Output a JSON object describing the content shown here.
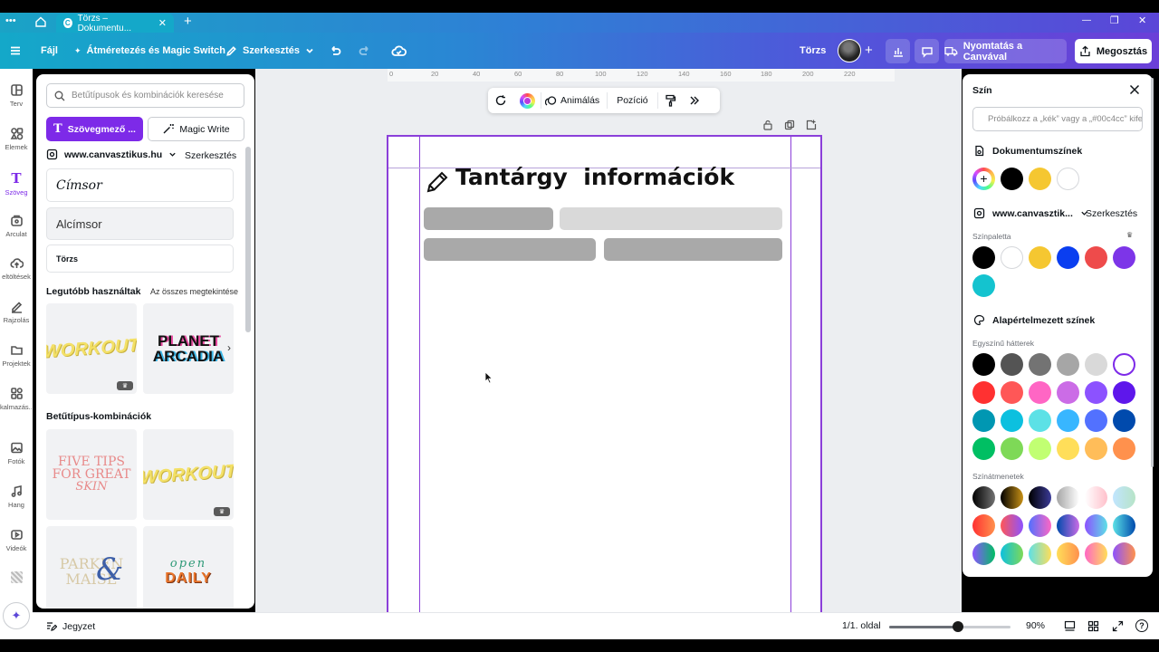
{
  "browser": {
    "tab_title": "Törzs – Dokumentu...",
    "tab_close": "✕",
    "new_tab": "+",
    "win_min": "—",
    "win_max": "❐",
    "win_close": "✕"
  },
  "toolbar": {
    "file": "Fájl",
    "resize": "Átméretezés és Magic Switch",
    "edit": "Szerkesztés",
    "doc_title": "Törzs",
    "print": "Nyomtatás a Canvával",
    "share": "Megosztás"
  },
  "rail": [
    {
      "label": "Terv",
      "icon": "layout-icon"
    },
    {
      "label": "Elemek",
      "icon": "shapes-icon"
    },
    {
      "label": "Szöveg",
      "icon": "text-icon"
    },
    {
      "label": "Arculat",
      "icon": "brand-icon"
    },
    {
      "label": "eltöltések",
      "icon": "upload-icon"
    },
    {
      "label": "Rajzolás",
      "icon": "draw-icon"
    },
    {
      "label": "Projektek",
      "icon": "folder-icon"
    },
    {
      "label": "kalmazás...",
      "icon": "apps-icon"
    },
    {
      "label": "Fotók",
      "icon": "photo-icon"
    },
    {
      "label": "Hang",
      "icon": "music-icon"
    },
    {
      "label": "Videók",
      "icon": "video-icon"
    }
  ],
  "panel": {
    "search_placeholder": "Betűtípusok és kombinációk keresése",
    "textbox_button": "Szövegmező ...",
    "magic_write": "Magic Write",
    "brand_name": "www.canvasztikus.hu",
    "brand_edit": "Szerkesztés",
    "heading": "Címsor",
    "subheading": "Alcímsor",
    "body": "Törzs",
    "recent_title": "Legutóbb használtak",
    "see_all": "Az összes megtekintése",
    "combos_title": "Betűtípus-kombinációk",
    "thumbs": {
      "workout": "WORKOUT",
      "planet1": "PLANET",
      "planet2": "ARCADIA",
      "five1": "FIVE TIPS",
      "five2": "FOR GREAT",
      "five3": "SKIN",
      "parken1": "PARKEN",
      "parken2": "MAISE",
      "open1": "open",
      "open2": "DAILY"
    }
  },
  "ruler": [
    "0",
    "20",
    "40",
    "60",
    "80",
    "100",
    "120",
    "140",
    "160",
    "180",
    "200",
    "220"
  ],
  "context_bar": {
    "animate": "Animálás",
    "position": "Pozíció"
  },
  "canvas": {
    "title": "Tantárgy  információk",
    "bar_dark": "#a9a9a9",
    "bar_light": "#d9d9d9"
  },
  "color_panel": {
    "title": "Szín",
    "search_placeholder": "Próbálkozz a „kék” vagy a „#00c4cc” kifejezéssel",
    "doc_colors": "Dokumentumszínek",
    "doc_swatches": [
      "#000000",
      "#f5c731",
      "#ffffff"
    ],
    "brand_name": "www.canvasztik...",
    "brand_edit": "Szerkesztés",
    "palette_label": "Színpaletta",
    "palette": [
      "#000000",
      "#ffffff",
      "#f5c731",
      "#0a3ef0",
      "#ee4b4b",
      "#7d35e8",
      "#14c3cf"
    ],
    "default_colors": "Alapértelmezett színek",
    "solid_label": "Egyszínű hátterek",
    "solids": [
      "#000000",
      "#545454",
      "#737373",
      "#a6a6a6",
      "#d9d9d9",
      "#ffffff",
      "#ff3131",
      "#ff5757",
      "#ff66c4",
      "#cb6ce6",
      "#8c52ff",
      "#5e17eb",
      "#0097b2",
      "#0cc0df",
      "#5ce1e6",
      "#38b6ff",
      "#5271ff",
      "#004aad",
      "#00bf63",
      "#7ed957",
      "#c1ff72",
      "#ffde59",
      "#ffbd59",
      "#ff914d"
    ],
    "gradient_label": "Színátmenetek"
  },
  "footer": {
    "notes": "Jegyzet",
    "page": "1/1. oldal",
    "zoom": "90%",
    "zoom_level": 0.57
  }
}
